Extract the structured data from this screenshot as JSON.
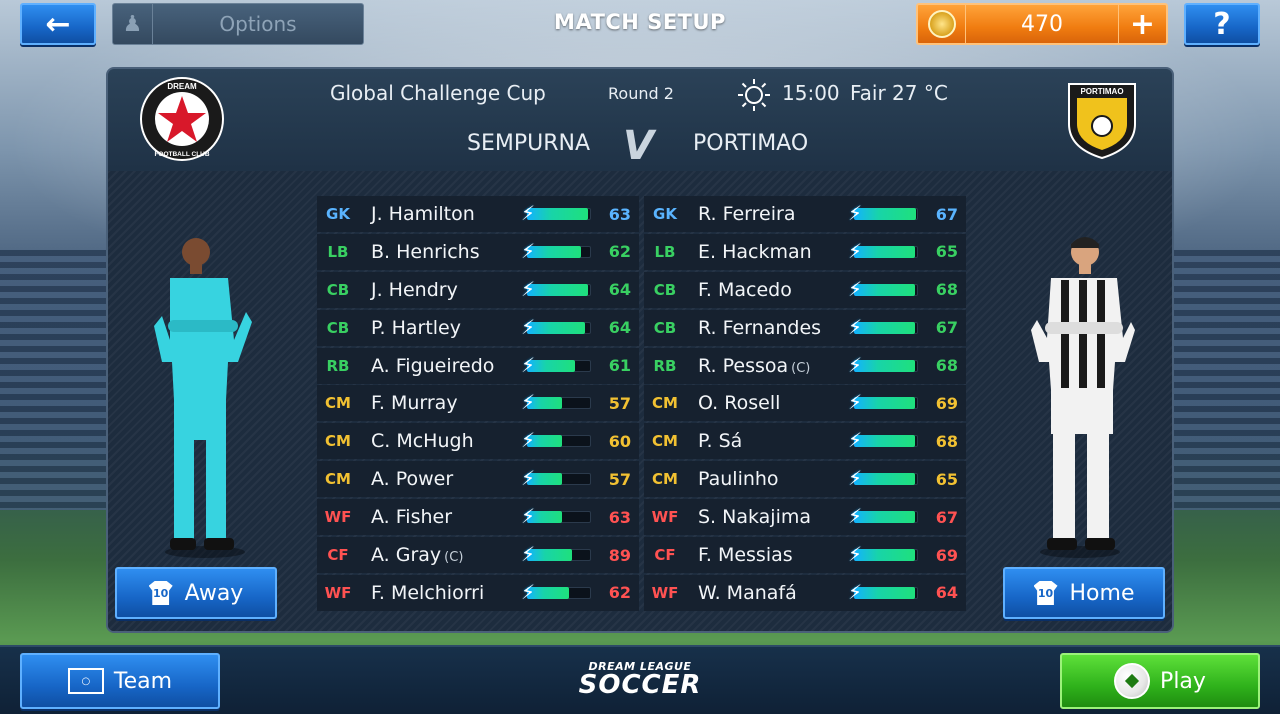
{
  "header": {
    "options_label": "Options",
    "title": "MATCH SETUP",
    "coins": "470"
  },
  "match": {
    "competition": "Global Challenge Cup",
    "round": "Round 2",
    "time": "15:00",
    "weather": "Fair 27 °C",
    "home_team": "SEMPURNA",
    "vs": "V",
    "away_team": "PORTIMAO",
    "home_logo_text_top": "DREAM",
    "home_logo_text_bottom": "FOOTBALL CLUB",
    "away_logo_text": "PORTIMAO"
  },
  "lineup_home": [
    {
      "pos": "GK",
      "name": "J. Hamilton",
      "cap": "",
      "rating": "63",
      "stamina": 0.95
    },
    {
      "pos": "LB",
      "name": "B. Henrichs",
      "cap": "",
      "rating": "62",
      "stamina": 0.85
    },
    {
      "pos": "CB",
      "name": "J. Hendry",
      "cap": "",
      "rating": "64",
      "stamina": 0.95
    },
    {
      "pos": "CB",
      "name": "P. Hartley",
      "cap": "",
      "rating": "64",
      "stamina": 0.9
    },
    {
      "pos": "RB",
      "name": "A. Figueiredo",
      "cap": "",
      "rating": "61",
      "stamina": 0.75
    },
    {
      "pos": "CM",
      "name": "F. Murray",
      "cap": "",
      "rating": "57",
      "stamina": 0.55
    },
    {
      "pos": "CM",
      "name": "C. McHugh",
      "cap": "",
      "rating": "60",
      "stamina": 0.55
    },
    {
      "pos": "CM",
      "name": "A. Power",
      "cap": "",
      "rating": "57",
      "stamina": 0.55
    },
    {
      "pos": "WF",
      "name": "A. Fisher",
      "cap": "",
      "rating": "63",
      "stamina": 0.55
    },
    {
      "pos": "CF",
      "name": "A. Gray",
      "cap": "(C)",
      "rating": "89",
      "stamina": 0.7
    },
    {
      "pos": "WF",
      "name": "F. Melchiorri",
      "cap": "",
      "rating": "62",
      "stamina": 0.65
    }
  ],
  "lineup_away": [
    {
      "pos": "GK",
      "name": "R. Ferreira",
      "cap": "",
      "rating": "67",
      "stamina": 0.97
    },
    {
      "pos": "LB",
      "name": "E. Hackman",
      "cap": "",
      "rating": "65",
      "stamina": 0.95
    },
    {
      "pos": "CB",
      "name": "F. Macedo",
      "cap": "",
      "rating": "68",
      "stamina": 0.95
    },
    {
      "pos": "CB",
      "name": "R. Fernandes",
      "cap": "",
      "rating": "67",
      "stamina": 0.95
    },
    {
      "pos": "RB",
      "name": "R. Pessoa",
      "cap": "(C)",
      "rating": "68",
      "stamina": 0.95
    },
    {
      "pos": "CM",
      "name": "O. Rosell",
      "cap": "",
      "rating": "69",
      "stamina": 0.95
    },
    {
      "pos": "CM",
      "name": "P. Sá",
      "cap": "",
      "rating": "68",
      "stamina": 0.95
    },
    {
      "pos": "CM",
      "name": "Paulinho",
      "cap": "",
      "rating": "65",
      "stamina": 0.95
    },
    {
      "pos": "WF",
      "name": "S. Nakajima",
      "cap": "",
      "rating": "67",
      "stamina": 0.95
    },
    {
      "pos": "CF",
      "name": "F. Messias",
      "cap": "",
      "rating": "69",
      "stamina": 0.95
    },
    {
      "pos": "WF",
      "name": "W. Manafá",
      "cap": "",
      "rating": "64",
      "stamina": 0.95
    }
  ],
  "kits": {
    "left_label": "Away",
    "right_label": "Home",
    "shirt_number": "10"
  },
  "footer": {
    "team_label": "Team",
    "brand_line1": "DREAM LEAGUE",
    "brand_line2": "SOCCER",
    "play_label": "Play"
  },
  "colors": {
    "gk": "#5ab4ff",
    "defender": "#39d062",
    "midfielder": "#f2c132",
    "attacker": "#ff5252",
    "home_kit": "#37d3e0",
    "away_kit": "#f2f2f2"
  }
}
